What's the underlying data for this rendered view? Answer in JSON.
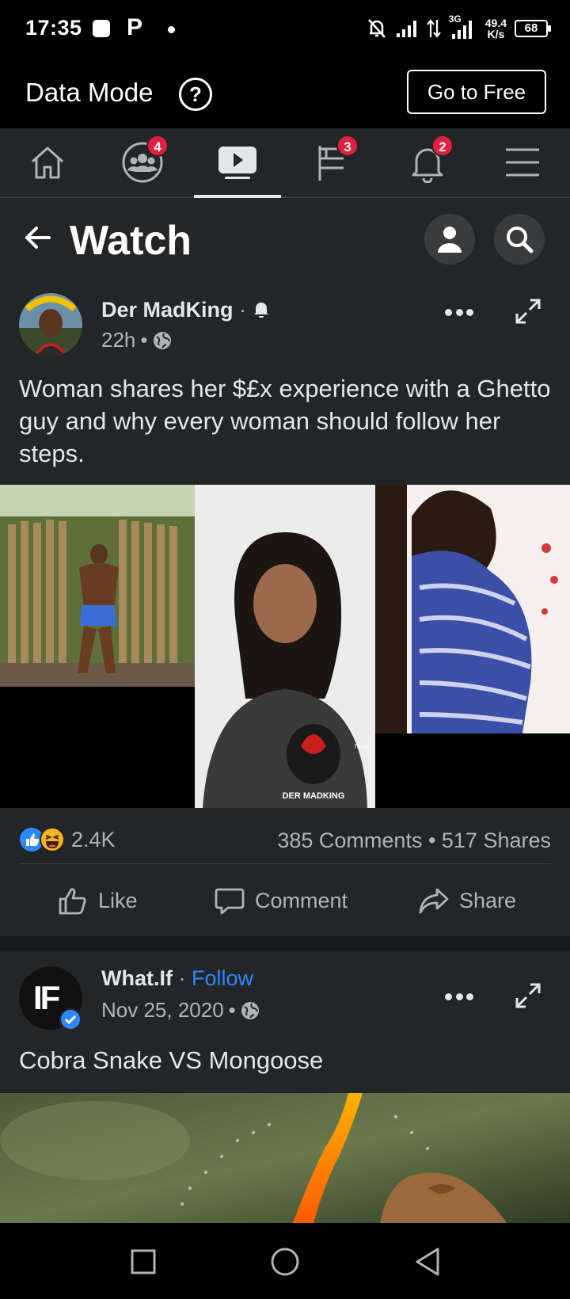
{
  "status_bar": {
    "time": "17:35",
    "carrier_letter": "P",
    "net_speed_value": "49.4",
    "net_speed_unit": "K/s",
    "network_type": "3G",
    "battery": "68"
  },
  "data_mode": {
    "label": "Data Mode",
    "help_symbol": "?",
    "go_free_label": "Go to Free"
  },
  "nav": {
    "items": [
      {
        "icon": "home-icon",
        "badge": ""
      },
      {
        "icon": "groups-icon",
        "badge": "4"
      },
      {
        "icon": "watch-icon",
        "badge": ""
      },
      {
        "icon": "pages-flag-icon",
        "badge": "3"
      },
      {
        "icon": "bell-icon",
        "badge": "2"
      },
      {
        "icon": "menu-icon",
        "badge": ""
      }
    ]
  },
  "header": {
    "title": "Watch"
  },
  "post1": {
    "author": "Der MadKing",
    "separator": "·",
    "time": "22h",
    "caption": "Woman shares her $£x experience with a Ghetto guy and why every woman should follow her steps.",
    "reaction_count": "2.4K",
    "comments_shares": "385 Comments • 517 Shares",
    "watermark": "DER MADKING",
    "tiktok": "TikTok",
    "actions": {
      "like": "Like",
      "comment": "Comment",
      "share": "Share"
    }
  },
  "post2": {
    "author": "What.If",
    "separator": "·",
    "follow": "Follow",
    "time": "Nov 25, 2020",
    "caption": "Cobra Snake VS Mongoose",
    "avatar_text": "IF"
  },
  "colors": {
    "background": "#242526",
    "accent_blue": "#2d88ff",
    "badge_red": "#e41e3f",
    "text_primary": "#e4e6eb",
    "text_secondary": "#b0b3b8"
  }
}
